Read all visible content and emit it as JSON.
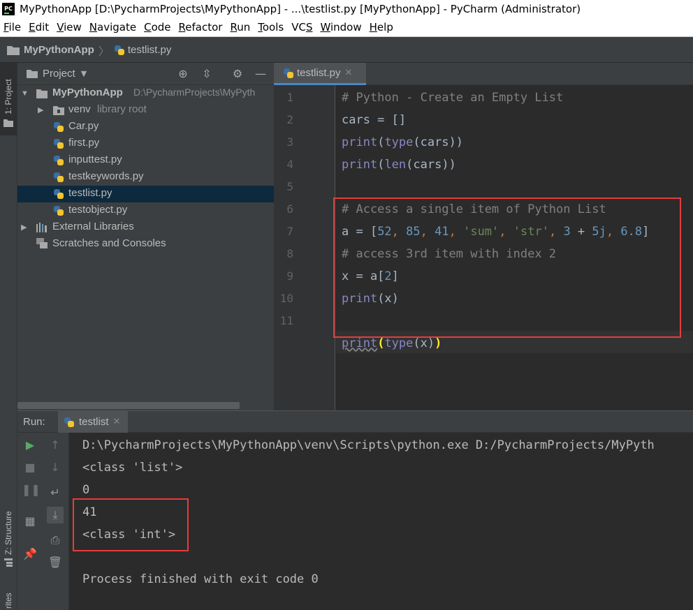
{
  "window": {
    "title": "MyPythonApp [D:\\PycharmProjects\\MyPythonApp] - ...\\testlist.py [MyPythonApp] - PyCharm (Administrator)",
    "logo_text": "PC"
  },
  "menu": [
    {
      "u": "F",
      "rest": "ile"
    },
    {
      "u": "E",
      "rest": "dit"
    },
    {
      "u": "V",
      "rest": "iew"
    },
    {
      "u": "N",
      "rest": "avigate"
    },
    {
      "u": "C",
      "rest": "ode"
    },
    {
      "u": "R",
      "rest": "efactor"
    },
    {
      "u": "R",
      "rest": "un",
      "pre": ""
    },
    {
      "u": "T",
      "rest": "ools"
    },
    {
      "pre": "VC",
      "u": "S",
      "rest": ""
    },
    {
      "u": "W",
      "rest": "indow"
    },
    {
      "u": "H",
      "rest": "elp"
    }
  ],
  "breadcrumb": {
    "project": "MyPythonApp",
    "file": "testlist.py"
  },
  "left_stripe": {
    "project_tab": "1: Project",
    "structure_tab": "Z: Structure",
    "favorites_tab": "rites"
  },
  "project_panel": {
    "title": "Project",
    "root_name": "MyPythonApp",
    "root_path": "D:\\PycharmProjects\\MyPyth",
    "venv": "venv",
    "venv_hint": "library root",
    "files": [
      "Car.py",
      "first.py",
      "inputtest.py",
      "testkeywords.py",
      "testlist.py",
      "testobject.py"
    ],
    "selected_file": "testlist.py",
    "external_libraries": "External Libraries",
    "scratches": "Scratches and Consoles"
  },
  "editor": {
    "tab": "testlist.py",
    "line_numbers": [
      "1",
      "2",
      "3",
      "4",
      "5",
      "6",
      "7",
      "8",
      "9",
      "10",
      "11"
    ],
    "lines": {
      "l1": "# Python - Create an Empty List",
      "l2a": "cars = []",
      "l3a": "print",
      "l3b": "(",
      "l3c": "type",
      "l3d": "(cars))",
      "l4a": "print",
      "l4b": "(",
      "l4c": "len",
      "l4d": "(cars))",
      "l6": "# Access a single item of Python List",
      "l7": {
        "prefix": "a = [",
        "n1": "52",
        "n2": "85",
        "n3": "41",
        "s1": "'sum'",
        "s2": "'str'",
        "n4": "3",
        "plus": " + ",
        "n5": "5j",
        "n6": "6.8",
        "comma": ", ",
        "close": "]"
      },
      "l8": "# access 3rd item with index 2",
      "l9a": "x = a[",
      "l9b": "2",
      "l9c": "]",
      "l10a": "print",
      "l10b": "(x)",
      "l11a": "print",
      "l11b": "(",
      "l11c": "type",
      "l11d": "(x)",
      "l11e": ")"
    }
  },
  "run_panel": {
    "label": "Run:",
    "tab": "testlist",
    "output": [
      "D:\\PycharmProjects\\MyPythonApp\\venv\\Scripts\\python.exe D:/PycharmProjects/MyPyth",
      "<class 'list'>",
      "0",
      "41",
      "<class 'int'>",
      "",
      "Process finished with exit code 0"
    ]
  },
  "colors": {
    "highlight_box": "#e83b3b",
    "selection": "#0d293e",
    "accent": "#4a88c7"
  }
}
